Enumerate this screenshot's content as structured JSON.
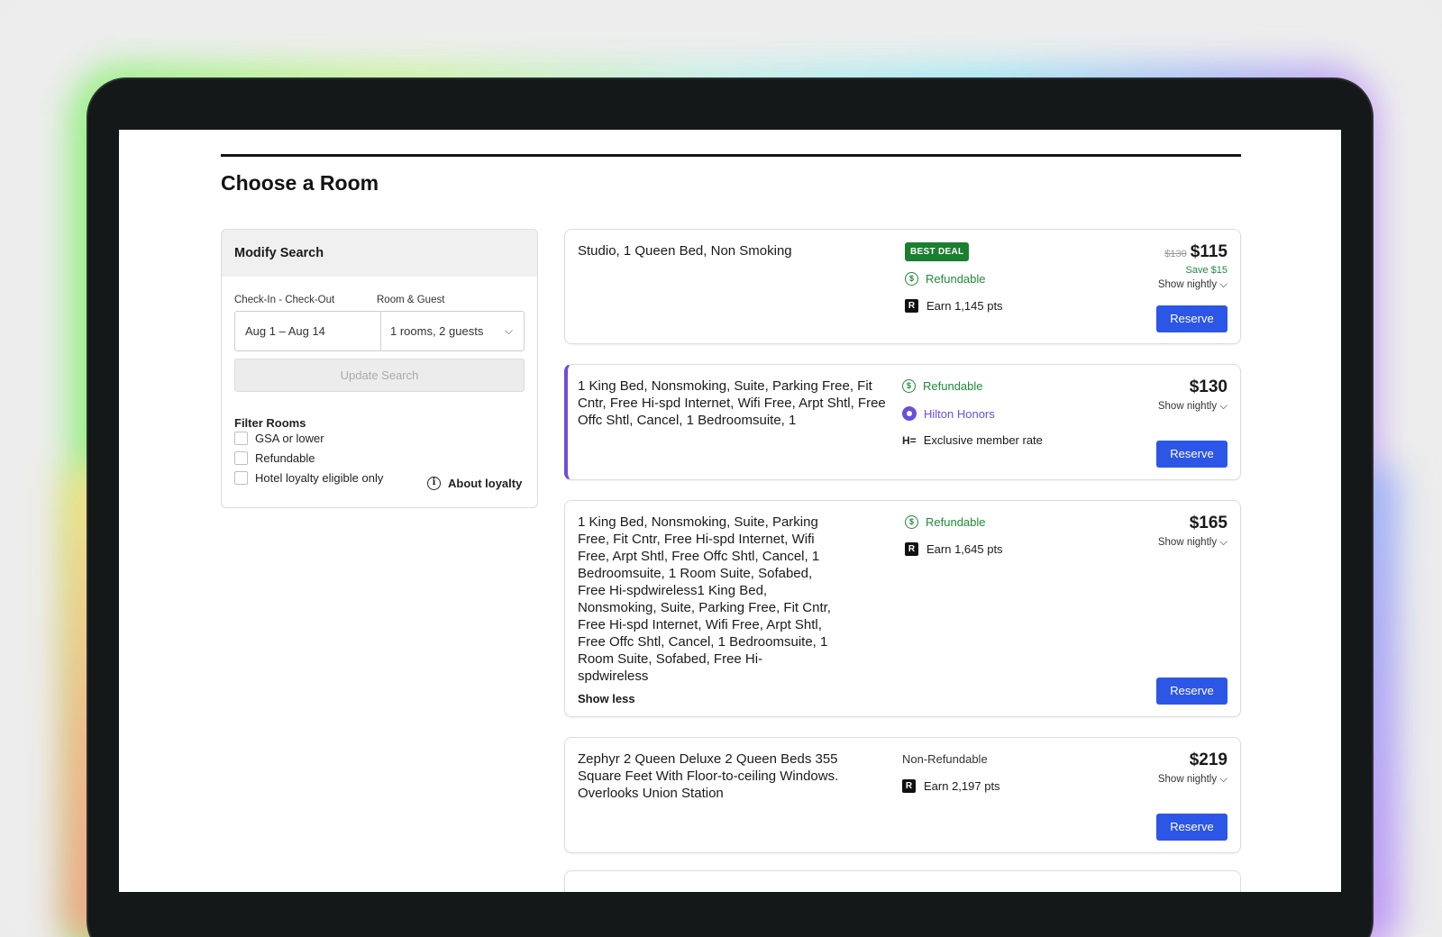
{
  "page": {
    "title": "Choose a Room"
  },
  "modify_search": {
    "title": "Modify Search",
    "checkin_label": "Check-In - Check-Out",
    "guest_label": "Room & Guest",
    "dates_value": "Aug 1 – Aug 14",
    "guests_value": "1 rooms, 2 guests",
    "update_label": "Update Search",
    "filter_title": "Filter Rooms",
    "filters": [
      "GSA or lower",
      "Refundable",
      "Hotel loyalty eligible only"
    ],
    "about_loyalty": "About loyalty"
  },
  "rooms": [
    {
      "name": "Studio, 1 Queen Bed, Non Smoking",
      "badge": "BEST DEAL",
      "refund": "Refundable",
      "points": "Earn 1,145 pts",
      "old_price": "$130",
      "price": "$115",
      "save": "Save $15",
      "nightly": "Show nightly",
      "reserve": "Reserve"
    },
    {
      "name": "1 King Bed, Nonsmoking, Suite, Parking Free, Fit Cntr, Free Hi-spd Internet, Wifi Free, Arpt Shtl, Free Offc Shtl, Cancel, 1 Bedroomsuite, 1",
      "refund": "Refundable",
      "loyalty": "Hilton Honors",
      "member": "Exclusive member rate",
      "price": "$130",
      "nightly": "Show nightly",
      "reserve": "Reserve"
    },
    {
      "name": "1 King Bed, Nonsmoking, Suite, Parking Free, Fit Cntr, Free Hi-spd Internet, Wifi Free, Arpt Shtl, Free Offc Shtl, Cancel, 1 Bedroomsuite, 1 Room Suite, Sofabed, Free Hi-spdwireless1 King Bed, Nonsmoking, Suite, Parking Free, Fit Cntr, Free Hi-spd Internet, Wifi Free, Arpt Shtl, Free Offc Shtl, Cancel, 1 Bedroomsuite, 1 Room Suite, Sofabed, Free Hi-spdwireless",
      "show_less": "Show less",
      "refund": "Refundable",
      "points": "Earn 1,645 pts",
      "price": "$165",
      "nightly": "Show nightly",
      "reserve": "Reserve"
    },
    {
      "name": "Zephyr 2 Queen Deluxe 2 Queen Beds 355 Square Feet With Floor-to-ceiling Windows. Overlooks Union Station",
      "refund": "Non-Refundable",
      "points": "Earn 2,197 pts",
      "price": "$219",
      "nightly": "Show nightly",
      "reserve": "Reserve"
    }
  ],
  "icons": {
    "refund": "dollar-circle-icon",
    "points": "rewards-r-icon",
    "hilton": "hilton-honors-icon",
    "member": "h-equals-icon",
    "chevron": "chevron-down-icon",
    "info": "info-icon"
  },
  "colors": {
    "accent": "#2c56e6",
    "green": "#1f8a3a",
    "purple": "#6b4fd8",
    "badge": "#1a7f2e"
  }
}
